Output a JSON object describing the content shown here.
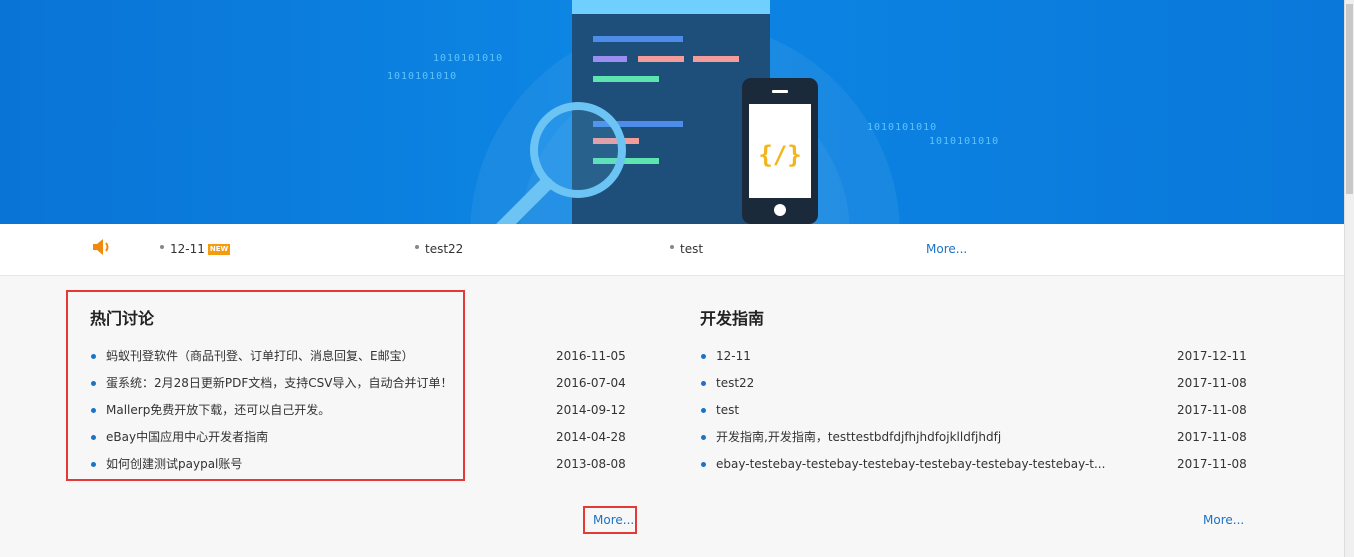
{
  "banner": {
    "binary_1": "1010101010",
    "binary_2": "1010101010",
    "binary_3": "1010101010",
    "binary_4": "1010101010",
    "code_glyph": "{/}"
  },
  "notice": {
    "items": [
      {
        "label": "12-11",
        "badge": "NEW"
      },
      {
        "label": "test22"
      },
      {
        "label": "test"
      }
    ],
    "more": "More..."
  },
  "hot_discussions": {
    "title": "热门讨论",
    "items": [
      {
        "text": "蚂蚁刊登软件（商品刊登、订单打印、消息回复、E邮宝）",
        "date": "2016-11-05"
      },
      {
        "text": "蛋系统：2月28日更新PDF文档，支持CSV导入，自动合并订单！",
        "date": "2016-07-04"
      },
      {
        "text": "Mallerp免费开放下载，还可以自己开发。",
        "date": "2014-09-12"
      },
      {
        "text": "eBay中国应用中心开发者指南",
        "date": "2014-04-28"
      },
      {
        "text": "如何创建测试paypal账号",
        "date": "2013-08-08"
      }
    ],
    "more": "More..."
  },
  "dev_guide": {
    "title": "开发指南",
    "items": [
      {
        "text": "12-11",
        "date": "2017-12-11"
      },
      {
        "text": "test22",
        "date": "2017-11-08"
      },
      {
        "text": "test",
        "date": "2017-11-08"
      },
      {
        "text": "开发指南,开发指南，testtestbdfdjfhjhdfojklldfjhdfj",
        "date": "2017-11-08"
      },
      {
        "text": "ebay-testebay-testebay-testebay-testebay-testebay-testebay-t...",
        "date": "2017-11-08"
      }
    ],
    "more": "More..."
  },
  "colors": {
    "banner": "#0a7ddc",
    "link": "#1a73c7",
    "highlight": "#e53935",
    "badge": "#f39c12"
  }
}
